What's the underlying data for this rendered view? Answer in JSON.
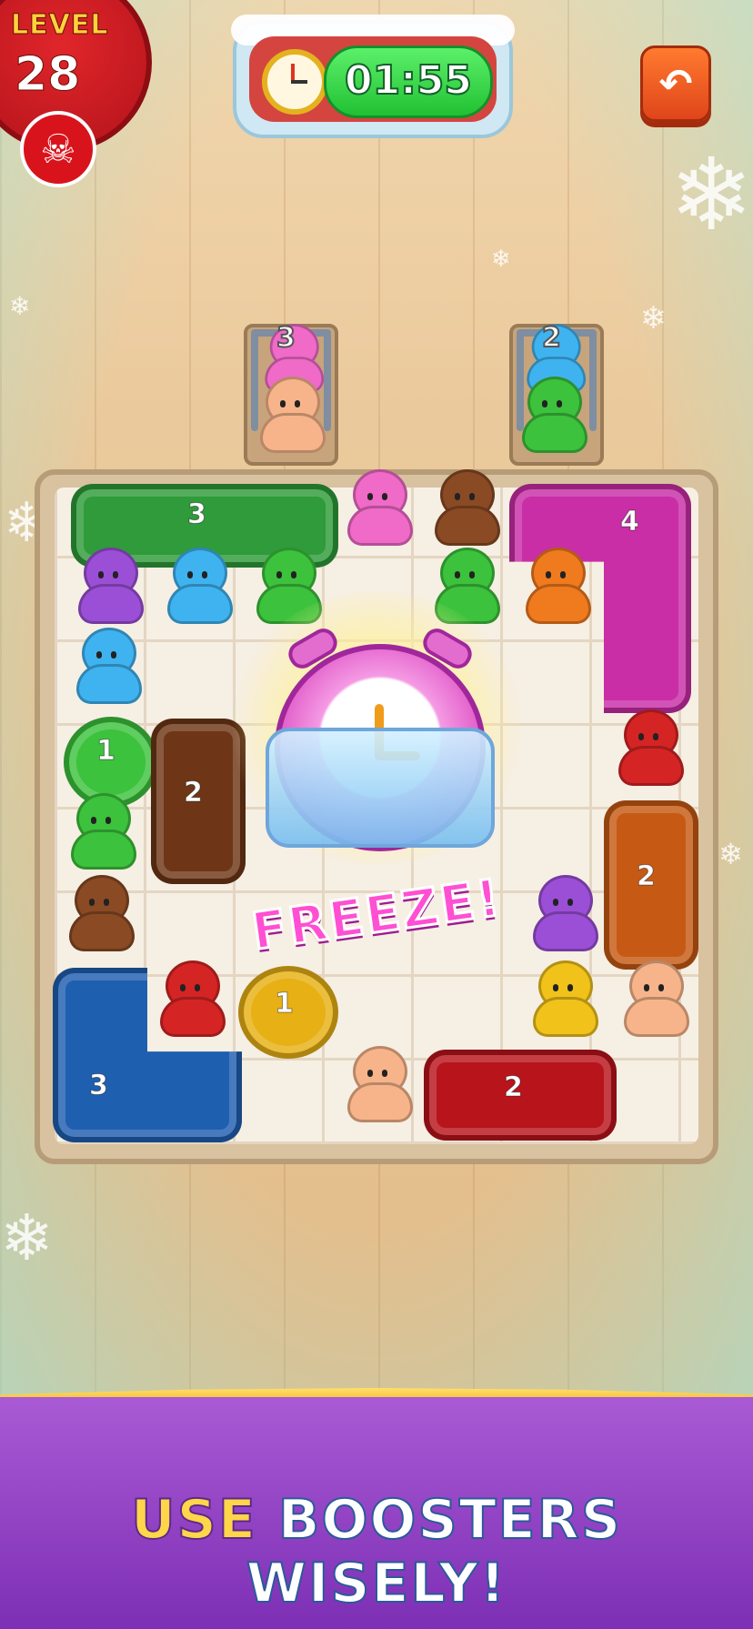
{
  "level": {
    "label": "LEVEL",
    "number": "28"
  },
  "timer": {
    "value": "01:55"
  },
  "queues": [
    {
      "count": "3"
    },
    {
      "count": "2"
    }
  ],
  "cars": {
    "green_top": "3",
    "pink_l": "4",
    "green_round": "1",
    "brown": "2",
    "orange_right": "2",
    "yellow_round": "1",
    "blue_l": "3",
    "red_bottom": "2"
  },
  "booster": {
    "text": "FREEZE!"
  },
  "banner": {
    "word1": "USE",
    "word2": "BOOSTERS",
    "word3": "WISELY!"
  },
  "colors": {
    "green": "#3cc23c",
    "pink": "#f06ac8",
    "brown": "#8a4a24",
    "blue": "#2d86d8",
    "red": "#d52424",
    "orange": "#f07a1e",
    "yellow": "#f0c21a",
    "purple": "#9b4fd6",
    "peach": "#f7b48a",
    "lightblue": "#3fb3f0"
  }
}
